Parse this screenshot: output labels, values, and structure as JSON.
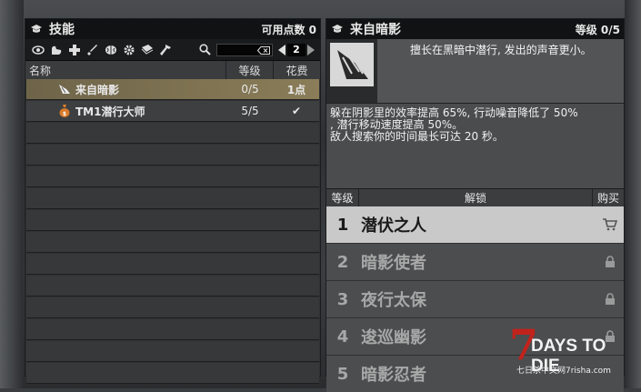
{
  "left_panel": {
    "title": "技能",
    "points_label": "可用点数",
    "points_value": "0",
    "page": "2",
    "columns": {
      "name": "名称",
      "level": "等级",
      "cost": "花费"
    },
    "toolbar_icons": [
      "eye-icon",
      "arm-icon",
      "medkit-icon",
      "sword-icon",
      "brain-icon",
      "gear-icon",
      "book-icon",
      "hammer-icon"
    ],
    "rows": [
      {
        "icon": "sneak-skill-icon",
        "name": "来自暗影",
        "level": "0/5",
        "cost": "1点"
      },
      {
        "icon": "bag-icon",
        "name": "TM1潜行大师",
        "level": "5/5",
        "cost": "✔"
      }
    ]
  },
  "right_panel": {
    "title": "来自暗影",
    "level_text": "等级 0/5",
    "description": "擅长在黑暗中潜行, 发出的声音更小。",
    "effect_lines": [
      "躲在阴影里的效率提高 65%, 行动噪音降低了 50%",
      ", 潜行移动速度提高 50%。",
      "敌人搜索你的时间最长可达 20 秒。"
    ],
    "columns": {
      "level": "等级",
      "unlock": "解锁",
      "buy": "购买"
    },
    "tiers": [
      {
        "num": "1",
        "name": "潜伏之人",
        "state": "buy"
      },
      {
        "num": "2",
        "name": "暗影使者",
        "state": "locked"
      },
      {
        "num": "3",
        "name": "夜行太保",
        "state": "locked"
      },
      {
        "num": "4",
        "name": "逡巡幽影",
        "state": "locked"
      },
      {
        "num": "5",
        "name": "暗影忍者",
        "state": "locked"
      }
    ]
  },
  "watermark": {
    "seven": "7",
    "title": "DAYS TO DIE",
    "subtitle": "七日杀中文网7risha.com"
  },
  "colors": {
    "selected_row": "#8a7d58",
    "active_tier": "#c9c9c9",
    "logo_red": "#c1231c"
  }
}
